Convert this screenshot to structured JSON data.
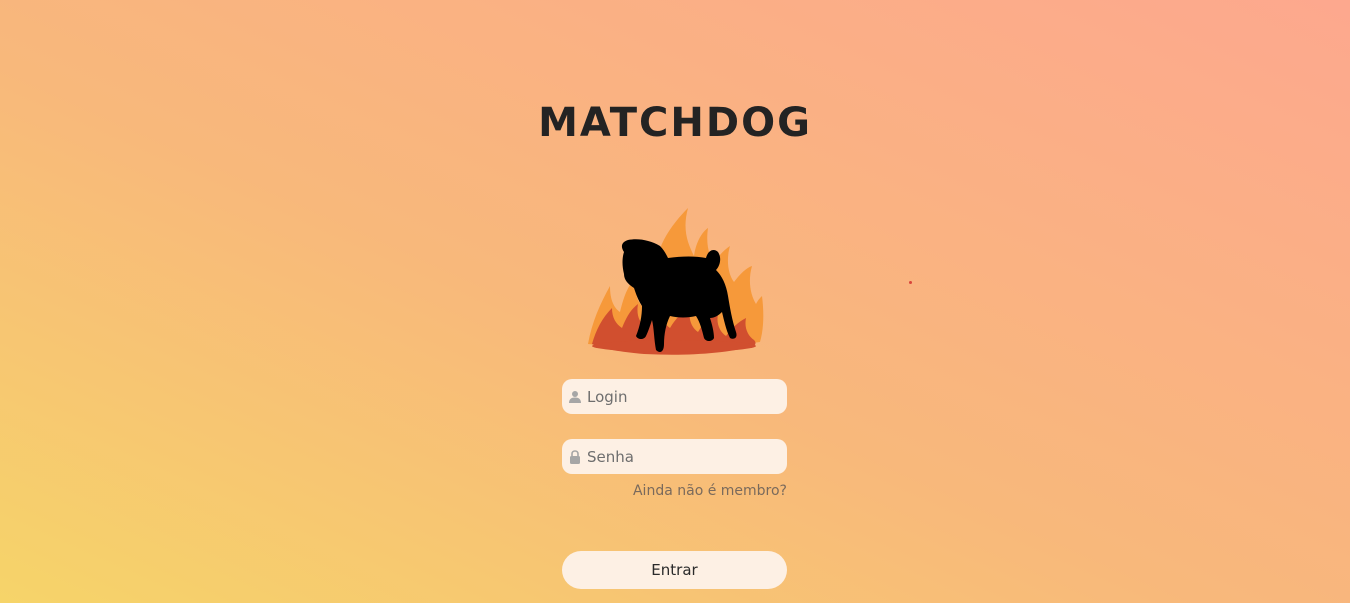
{
  "app": {
    "title": "MATCHDOG"
  },
  "logo": {
    "icon": "pug-on-fire-icon",
    "colors": {
      "flame_outer": "#f6993a",
      "flame_inner": "#d14f2f",
      "dog": "#000000"
    }
  },
  "form": {
    "login": {
      "placeholder": "Login",
      "value": "",
      "icon": "user-icon"
    },
    "password": {
      "placeholder": "Senha",
      "value": "",
      "icon": "lock-icon"
    },
    "signup_link": "Ainda não é membro?",
    "submit_label": "Entrar"
  },
  "theme": {
    "gradient_start": "#f6d469",
    "gradient_end": "#fda88e",
    "field_background": "#fdf0e4",
    "title_color": "#232323"
  }
}
